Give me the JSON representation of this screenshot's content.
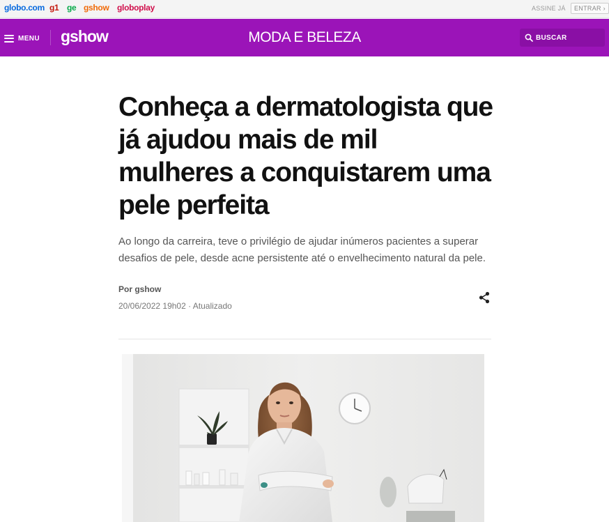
{
  "topbar": {
    "brands": [
      "globo.com",
      "g1",
      "ge",
      "gshow",
      "globoplay"
    ],
    "assine": "ASSINE JÁ",
    "entrar": "ENTRAR ›"
  },
  "header": {
    "menu_label": "MENU",
    "logo": "gshow",
    "section": "MODA E BELEZA",
    "search_label": "BUSCAR",
    "color": "#9b14b8"
  },
  "article": {
    "headline": "Conheça a dermatologista que já ajudou mais de mil mulheres a conquistarem uma pele perfeita",
    "subtitle": "Ao longo da carreira, teve o privilégio de ajudar inúmeros pacientes a superar desafios de pele, desde acne persistente até o envelhecimento natural da pele.",
    "byline": "Por gshow",
    "date": "20/06/2022 19h02 · Atualizado"
  },
  "icons": {
    "menu": "hamburger-icon",
    "search": "search-icon",
    "share": "share-icon"
  }
}
